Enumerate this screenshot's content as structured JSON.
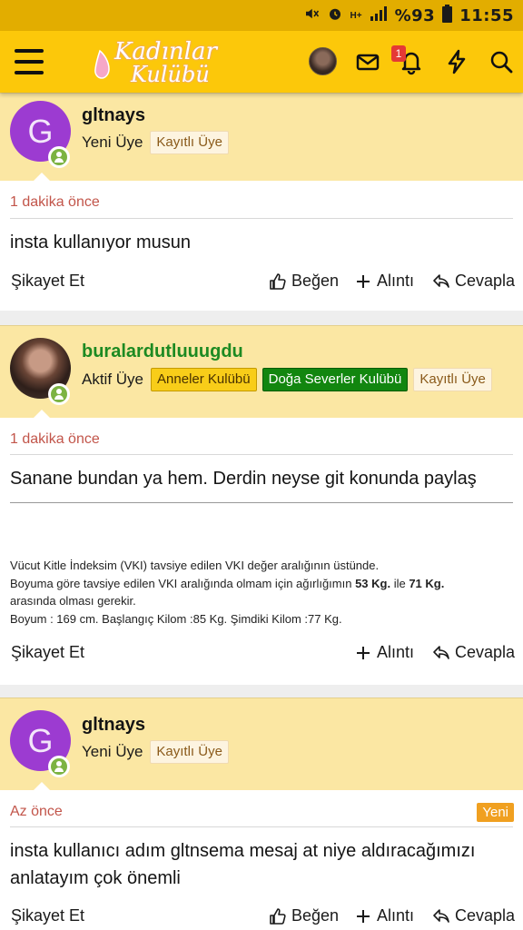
{
  "status_bar": {
    "battery": "%93",
    "time": "11:55"
  },
  "app_bar": {
    "logo_line1": "Kadınlar",
    "logo_line2": "Kulübü",
    "notification_count": "1"
  },
  "posts": [
    {
      "avatar_letter": "G",
      "username": "gltnays",
      "role": "Yeni Üye",
      "badges": [
        "Kayıtlı Üye"
      ],
      "time": "1 dakika önce",
      "body": "insta kullanıyor musun",
      "actions": {
        "report": "Şikayet Et",
        "like": "Beğen",
        "quote": "Alıntı",
        "reply": "Cevapla"
      }
    },
    {
      "username": "buralardutluuugdu",
      "role": "Aktif Üye",
      "badges": [
        "Anneler Kulübü",
        "Doğa Severler Kulübü",
        "Kayıtlı Üye"
      ],
      "time": "1 dakika önce",
      "body": "Sanane bundan ya hem. Derdin neyse git konunda paylaş",
      "signature": {
        "line1": "Vücut Kitle İndeksim (VKI) tavsiye edilen VKI değer aralığının üstünde.",
        "line2_a": "Boyuma göre tavsiye edilen VKI aralığında olmam için ağırlığımın ",
        "weight_min": "53 Kg.",
        "line2_b": " ile ",
        "weight_max": "71 Kg.",
        "line3": "arasında olması gerekir.",
        "line4": "Boyum : 169 cm. Başlangıç Kilom :85 Kg. Şimdiki Kilom :77 Kg."
      },
      "actions": {
        "report": "Şikayet Et",
        "quote": "Alıntı",
        "reply": "Cevapla"
      }
    },
    {
      "avatar_letter": "G",
      "username": "gltnays",
      "role": "Yeni Üye",
      "badges": [
        "Kayıtlı Üye"
      ],
      "time": "Az önce",
      "new_label": "Yeni",
      "body": "insta kullanıcı adım gltnsema mesaj at niye aldıracağımızı anlatayım çok önemli",
      "actions": {
        "report": "Şikayet Et",
        "like": "Beğen",
        "quote": "Alıntı",
        "reply": "Cevapla"
      }
    }
  ],
  "colors": {
    "app_bar": "#fcc80a",
    "post_header": "#fbe7a3",
    "time_text": "#c2554a",
    "online": "#7cb342"
  }
}
